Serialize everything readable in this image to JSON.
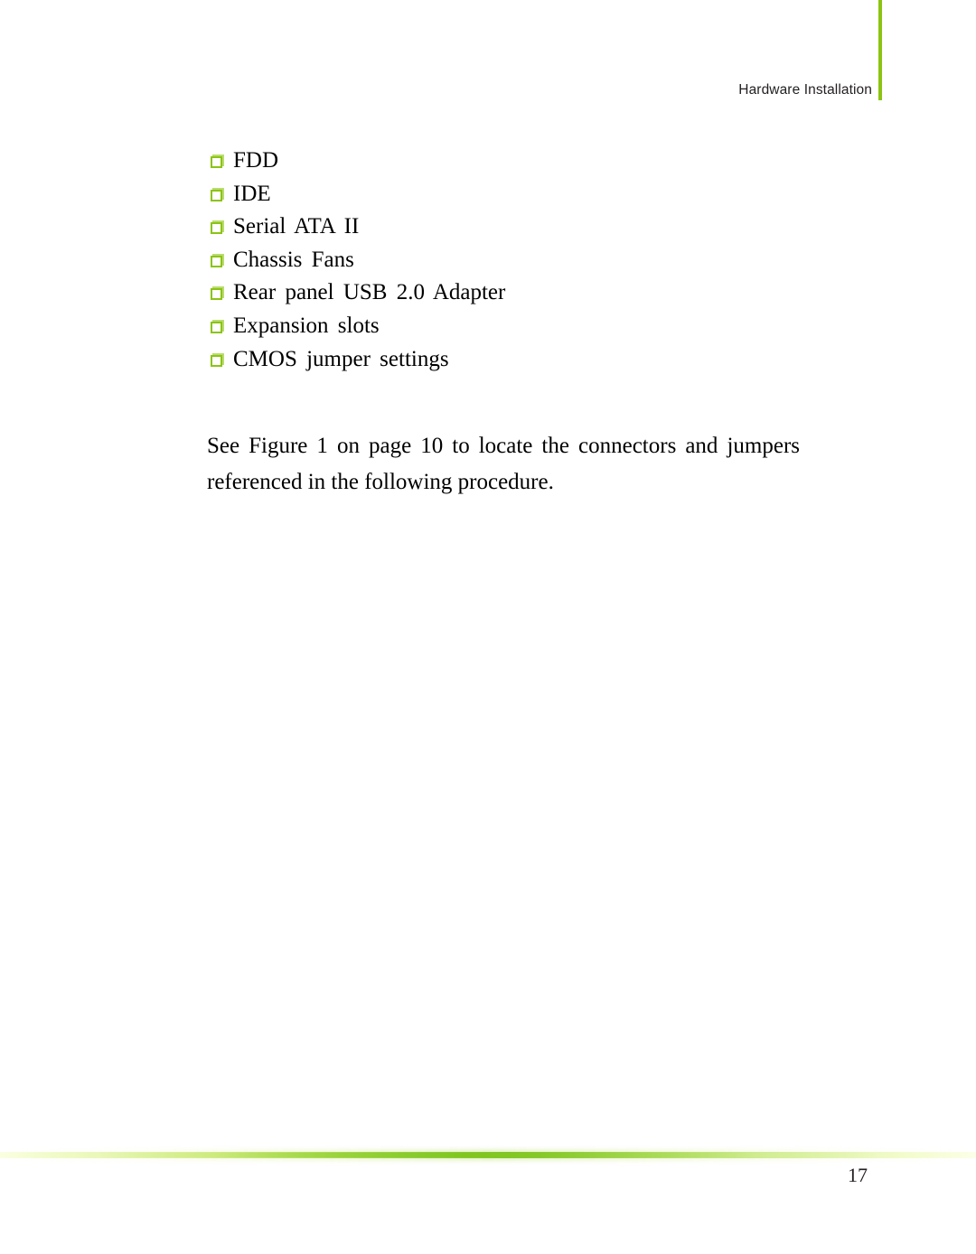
{
  "document": {
    "page_number": "17",
    "accent_color": "#8CC413",
    "accent_color_light": "#b9dd6d",
    "text_color": "#000000"
  },
  "header": {
    "title": "Hardware Installation",
    "rule_icon": "vertical-rule-icon"
  },
  "main": {
    "bullet_icon_name": "checkbox-square-icon",
    "bullets": [
      {
        "label": "FDD"
      },
      {
        "label": "IDE"
      },
      {
        "label": "Serial ATA II"
      },
      {
        "label": "Chassis Fans"
      },
      {
        "label": "Rear panel USB 2.0 Adapter"
      },
      {
        "label": "Expansion slots"
      },
      {
        "label": "CMOS jumper settings"
      }
    ],
    "paragraph": "See Figure 1 on page 10 to locate the connectors and jumpers referenced in the following procedure."
  },
  "footer": {
    "page_number": "17",
    "divider_icon": "gradient-divider-icon"
  }
}
